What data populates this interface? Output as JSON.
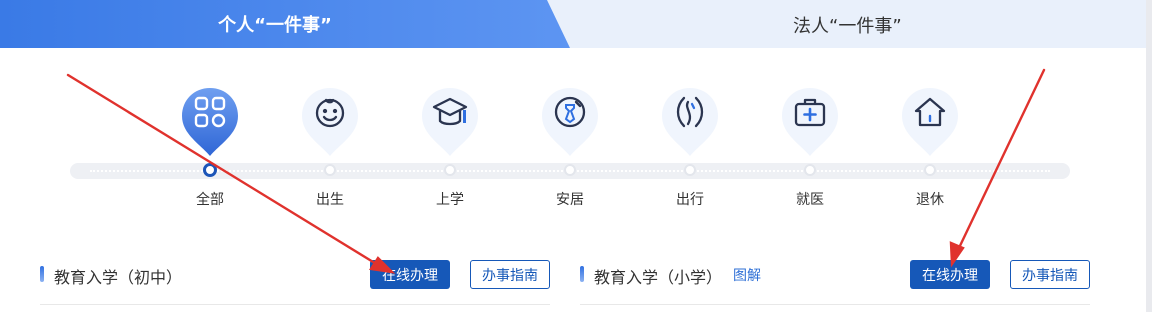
{
  "tabs": {
    "personal": "个人“一件事”",
    "legal": "法人“一件事”"
  },
  "categories": [
    {
      "label": "全部",
      "icon": "grid-icon",
      "active": true
    },
    {
      "label": "出生",
      "icon": "baby-face-icon",
      "active": false
    },
    {
      "label": "上学",
      "icon": "graduation-cap-icon",
      "active": false
    },
    {
      "label": "安居",
      "icon": "house-deed-icon",
      "active": false
    },
    {
      "label": "出行",
      "icon": "road-icon",
      "active": false
    },
    {
      "label": "就医",
      "icon": "medical-kit-icon",
      "active": false
    },
    {
      "label": "退休",
      "icon": "home-icon",
      "active": false
    }
  ],
  "services": [
    {
      "title": "教育入学（初中）",
      "link": "",
      "online_label": "在线办理",
      "guide_label": "办事指南"
    },
    {
      "title": "教育入学（小学）",
      "link": "图解",
      "online_label": "在线办理",
      "guide_label": "办事指南"
    }
  ],
  "colors": {
    "accent": "#1658b8",
    "tab_gradient_start": "#3a7ae6",
    "annotation_arrow": "#e0322d"
  }
}
